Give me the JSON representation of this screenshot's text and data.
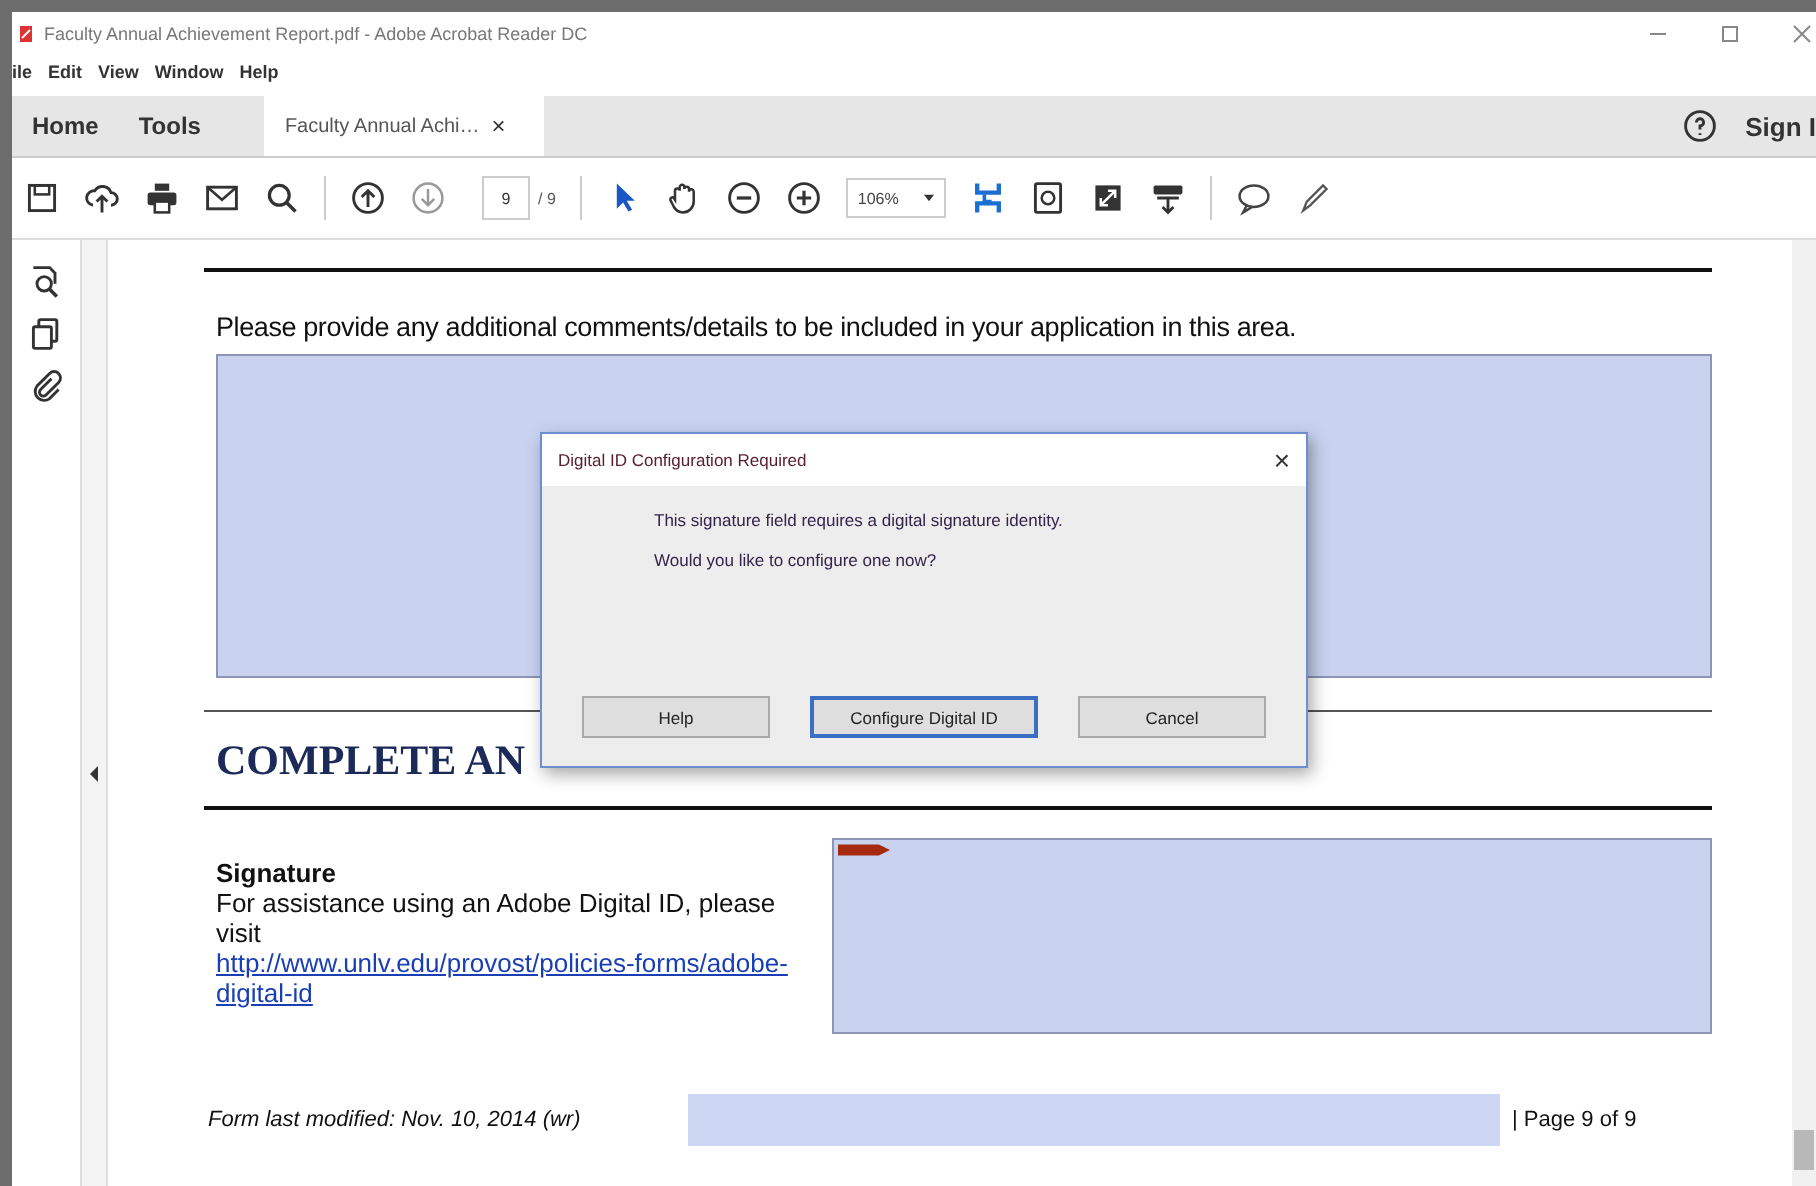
{
  "window": {
    "title": "Faculty Annual Achievement Report.pdf - Adobe Acrobat Reader DC"
  },
  "menu": [
    "ile",
    "Edit",
    "View",
    "Window",
    "Help"
  ],
  "tabs": [
    {
      "label": "Home",
      "selected": false
    },
    {
      "label": "Tools",
      "selected": false
    },
    {
      "label": "Faculty Annual Achi…",
      "selected": true,
      "close": "×"
    }
  ],
  "account": {
    "label": "Sign I"
  },
  "toolbar": {
    "page": "9",
    "page_total": "/ 9",
    "zoom": "106%"
  },
  "document": {
    "prompt": "Please provide any additional comments/details to be included in your application in this area.",
    "heading": "COMPLETE AN",
    "signature_label": "Signature",
    "signature_help": "For assistance using an Adobe Digital ID, please visit",
    "link": "http://www.unlv.edu/provost/policies-forms/adobe-digital-id",
    "footer_note": "Form last modified: Nov. 10, 2014 (wr)",
    "page_label": "| Page 9 of 9"
  },
  "dialog": {
    "title": "Digital ID Configuration Required",
    "close": "×",
    "messages": [
      "This signature field requires a digital signature identity.",
      "Would you like to configure one now?"
    ],
    "buttons": [
      {
        "label": "Help",
        "focused": false
      },
      {
        "label": "Configure Digital ID",
        "focused": true
      },
      {
        "label": "Cancel",
        "focused": false
      }
    ]
  }
}
